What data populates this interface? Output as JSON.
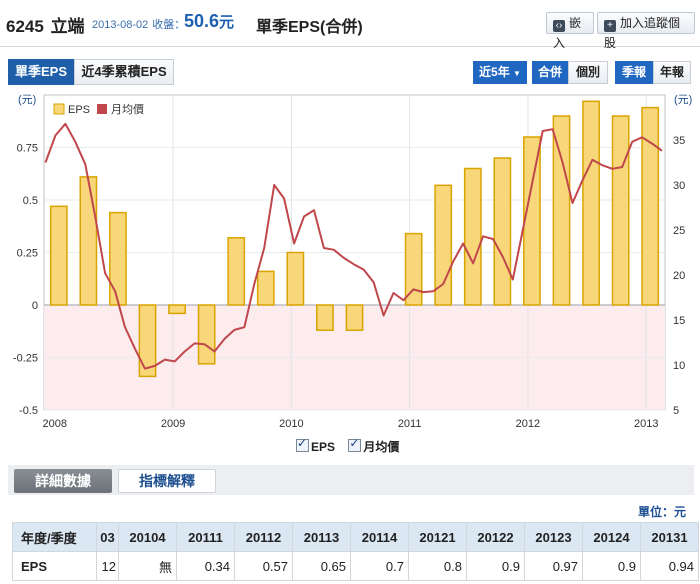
{
  "header": {
    "stock_code": "6245",
    "stock_name": "立端",
    "date": "2013-08-02",
    "price_label": "收盤：",
    "price_value": "50.6",
    "price_unit": "元",
    "page_title": "單季EPS(合併)",
    "embed_label": "嵌入",
    "watchlist_label": "加入追蹤個股"
  },
  "tabs": [
    "單季EPS",
    "近4季累積EPS"
  ],
  "controls": {
    "range_label": "近5年",
    "consolidated_label": "合併",
    "individual_label": "個別",
    "quarterly_label": "季報",
    "annual_label": "年報"
  },
  "chart_data": {
    "type": "bar+line",
    "left_axis_unit": "(元)",
    "right_axis_unit": "(元)",
    "ylim_left": [
      -0.5,
      1.0
    ],
    "yticks_left": [
      "-0.5",
      "-0.25",
      "0",
      "0.25",
      "0.5",
      "0.75"
    ],
    "ylim_right": [
      5,
      40
    ],
    "yticks_right": [
      "5",
      "10",
      "15",
      "20",
      "25",
      "30",
      "35"
    ],
    "x_labels": [
      "2008",
      "2009",
      "2010",
      "2011",
      "2012",
      "2013"
    ],
    "legend": [
      "EPS",
      "月均價"
    ],
    "colors": {
      "eps_bar": "#f7d77a",
      "eps_border": "#d9a400",
      "price_line": "#c0474b",
      "negative_bg": "#fcecee"
    },
    "quarters": [
      "2008Q1",
      "2008Q2",
      "2008Q3",
      "2008Q4",
      "2009Q1",
      "2009Q2",
      "2009Q3",
      "2009Q4",
      "2010Q1",
      "2010Q2",
      "2010Q3",
      "2010Q4",
      "2011Q1",
      "2011Q2",
      "2011Q3",
      "2011Q4",
      "2012Q1",
      "2012Q2",
      "2012Q3",
      "2012Q4",
      "2013Q1"
    ],
    "eps": [
      0.47,
      0.61,
      0.44,
      -0.34,
      -0.04,
      -0.28,
      0.32,
      0.16,
      0.25,
      -0.12,
      -0.12,
      0.0,
      0.34,
      0.57,
      0.65,
      0.7,
      0.8,
      0.9,
      0.97,
      0.9,
      0.94
    ],
    "monthly_price": [
      32.5,
      35.5,
      36.8,
      34.8,
      32.3,
      26.5,
      20.2,
      18.2,
      14.2,
      11.8,
      9.6,
      9.9,
      10.6,
      10.4,
      11.5,
      12.4,
      12.3,
      11.5,
      12.9,
      13.9,
      14.2,
      19.0,
      23.0,
      30.0,
      28.5,
      23.5,
      26.5,
      27.2,
      23.0,
      22.8,
      21.9,
      21.2,
      20.6,
      19.2,
      15.5,
      18.0,
      17.2,
      18.4,
      18.1,
      18.2,
      19.0,
      21.5,
      23.5,
      21.3,
      24.3,
      24.0,
      22.0,
      19.5,
      25.0,
      30.5,
      36.0,
      36.2,
      32.5,
      28.0,
      30.5,
      32.8,
      32.2,
      31.8,
      32.0,
      34.8,
      35.3,
      34.6,
      33.8
    ]
  },
  "detail": {
    "tab1": "詳細數據",
    "tab2": "指標解釋",
    "unit_label": "單位：元",
    "row_header": "年度/季度",
    "columns": [
      "03",
      "20104",
      "20111",
      "20112",
      "20113",
      "20114",
      "20121",
      "20122",
      "20123",
      "20124",
      "20131"
    ],
    "eps_label": "EPS",
    "eps_values": [
      "12",
      "無",
      "0.34",
      "0.57",
      "0.65",
      "0.7",
      "0.8",
      "0.9",
      "0.97",
      "0.9",
      "0.94"
    ]
  }
}
